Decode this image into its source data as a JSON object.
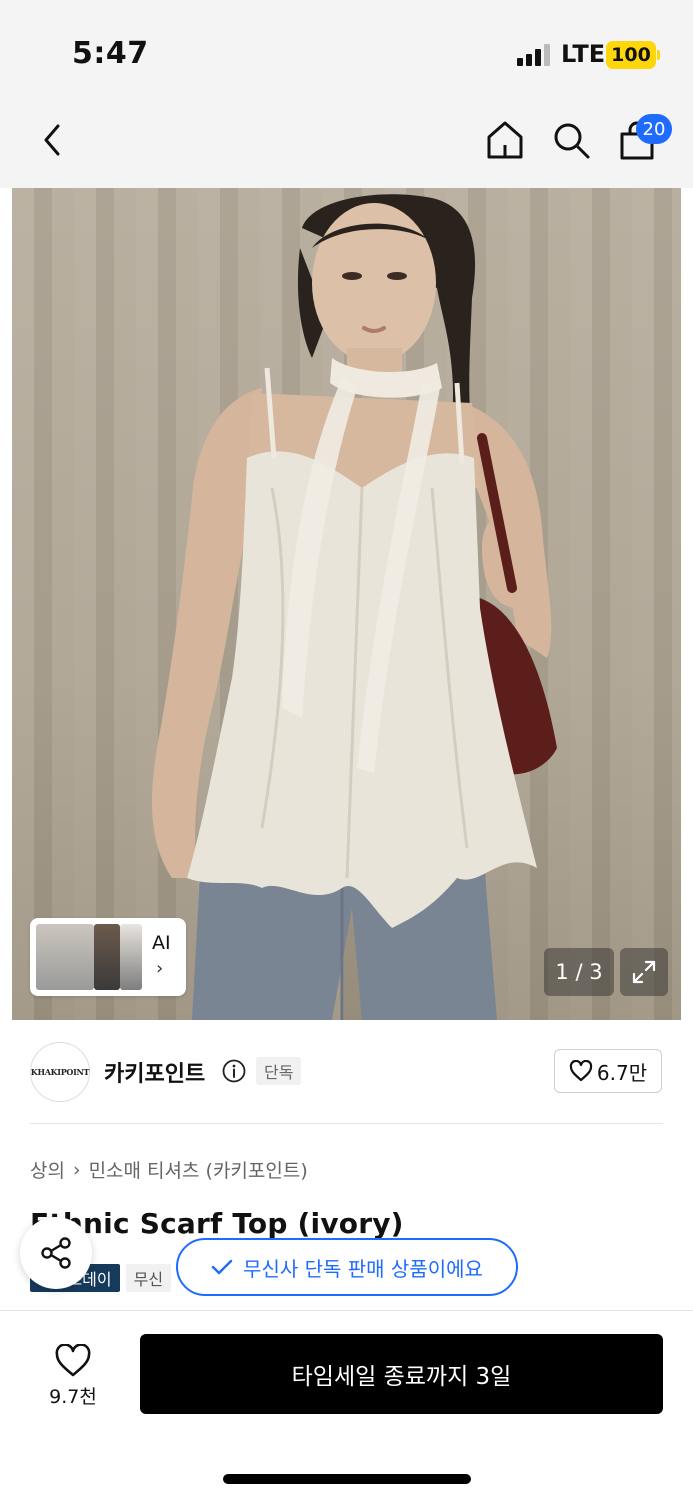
{
  "status_bar": {
    "time": "5:47",
    "network": "LTE",
    "battery": "100",
    "battery_color": "#ffd60a"
  },
  "nav": {
    "icons": [
      "back-icon",
      "home-icon",
      "search-icon",
      "cart-icon"
    ],
    "cart_count": "20",
    "badge_color": "#1e6bff"
  },
  "gallery": {
    "ai_label": "AI",
    "ai_chevron": "›",
    "counter": "1 / 3",
    "expand_icon": "expand-icon"
  },
  "brand": {
    "logo_text": "KHAKIPOINT",
    "name": "카키포인트",
    "info_icon": "info-icon",
    "exclusive_tag": "단독",
    "likes": "6.7만"
  },
  "product": {
    "breadcrumb": [
      "상의",
      "민소매 티셔츠 (카키포인트)"
    ],
    "breadcrumb_separator": "›",
    "title": "Ethnic Scarf Top (ivory)",
    "tags": [
      "메가스데이",
      "무신"
    ],
    "tag_dark_color": "#163a5c"
  },
  "toast": {
    "check_icon": "check-icon",
    "text": "무신사 단독 판매 상품이에요",
    "accent": "#1e6bff"
  },
  "bottom_bar": {
    "like_count": "9.7천",
    "buy_label": "타임세일 종료까지 3일"
  }
}
